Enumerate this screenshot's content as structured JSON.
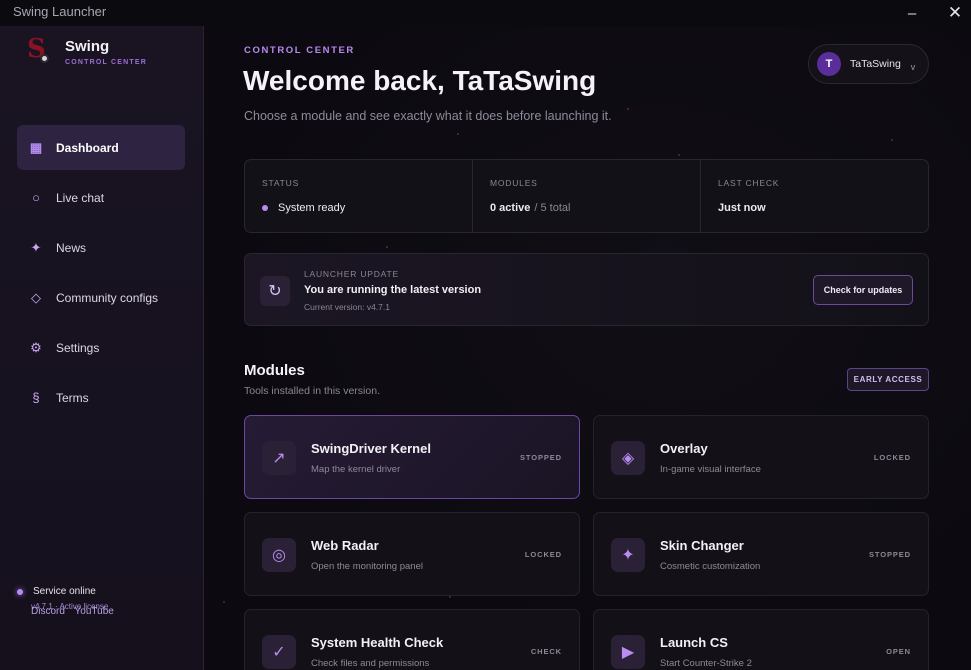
{
  "window": {
    "title": "Swing Launcher",
    "minimize": "–",
    "close": "✕"
  },
  "brand": {
    "name": "Swing",
    "subtitle": "CONTROL CENTER"
  },
  "sidebar": {
    "items": [
      {
        "label": "Dashboard",
        "icon": "dashboard-icon",
        "glyph": "▦",
        "active": true
      },
      {
        "label": "Live chat",
        "icon": "chat-icon",
        "glyph": "○",
        "active": false
      },
      {
        "label": "News",
        "icon": "sparkle-icon",
        "glyph": "✦",
        "active": false
      },
      {
        "label": "Community configs",
        "icon": "diamond-icon",
        "glyph": "◇",
        "active": false
      },
      {
        "label": "Settings",
        "icon": "gear-icon",
        "glyph": "⚙",
        "active": false
      },
      {
        "label": "Terms",
        "icon": "section-icon",
        "glyph": "§",
        "active": false
      }
    ],
    "service": {
      "status": "Service online",
      "version": "v4.7.1 · Active license"
    },
    "links": {
      "discord": "Discord",
      "youtube": "YouTube"
    }
  },
  "header": {
    "eyebrow": "CONTROL CENTER",
    "title": "Welcome back, TaTaSwing",
    "subtitle": "Choose a module and see exactly what it does before launching it."
  },
  "user": {
    "initial": "T",
    "name": "TaTaSwing",
    "caret": "v"
  },
  "stats": {
    "status_label": "STATUS",
    "status_value": "System ready",
    "modules_label": "MODULES",
    "modules_active": "0 active",
    "modules_total": "/ 5 total",
    "last_check_label": "LAST CHECK",
    "last_check_value": "Just now"
  },
  "update": {
    "label": "LAUNCHER UPDATE",
    "title": "You are running the latest version",
    "version": "Current version: v4.7.1",
    "button": "Check for updates"
  },
  "modules": {
    "title": "Modules",
    "subtitle": "Tools installed in this version.",
    "badge": "EARLY ACCESS",
    "items": [
      {
        "name": "SwingDriver Kernel",
        "desc": "Map the kernel driver",
        "status": "STOPPED",
        "icon": "arrow-up-right-icon",
        "glyph": "↗"
      },
      {
        "name": "Overlay",
        "desc": "In-game visual interface",
        "status": "LOCKED",
        "icon": "overlay-icon",
        "glyph": "◈"
      },
      {
        "name": "Web Radar",
        "desc": "Open the monitoring panel",
        "status": "LOCKED",
        "icon": "radar-icon",
        "glyph": "◎"
      },
      {
        "name": "Skin Changer",
        "desc": "Cosmetic customization",
        "status": "STOPPED",
        "icon": "sparkle-icon",
        "glyph": "✦"
      },
      {
        "name": "System Health Check",
        "desc": "Check files and permissions",
        "status": "CHECK",
        "icon": "check-icon",
        "glyph": "✓"
      },
      {
        "name": "Launch CS",
        "desc": "Start Counter-Strike 2",
        "status": "OPEN",
        "icon": "play-icon",
        "glyph": "▶"
      }
    ]
  }
}
